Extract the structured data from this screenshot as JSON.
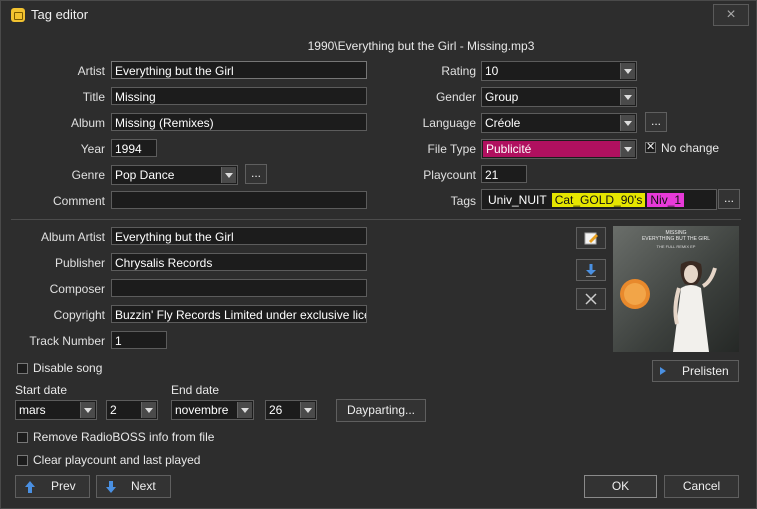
{
  "window": {
    "title": "Tag editor",
    "close_label": "×"
  },
  "file_path": "1990\\Everything but the Girl - Missing.mp3",
  "left_fields": {
    "artist": {
      "label": "Artist",
      "value": "Everything but the Girl"
    },
    "title": {
      "label": "Title",
      "value": "Missing"
    },
    "album": {
      "label": "Album",
      "value": "Missing (Remixes)"
    },
    "year": {
      "label": "Year",
      "value": "1994"
    },
    "genre": {
      "label": "Genre",
      "value": "Pop Dance"
    },
    "comment": {
      "label": "Comment",
      "value": ""
    }
  },
  "right_fields": {
    "rating": {
      "label": "Rating",
      "value": "10"
    },
    "gender": {
      "label": "Gender",
      "value": "Group"
    },
    "language": {
      "label": "Language",
      "value": "Créole"
    },
    "file_type": {
      "label": "File Type",
      "value": "Publicité"
    },
    "no_change": {
      "label": "No change",
      "checked": true
    },
    "playcount": {
      "label": "Playcount",
      "value": "21"
    },
    "tags": {
      "label": "Tags",
      "items": [
        {
          "text": "Univ_NUIT",
          "color": ""
        },
        {
          "text": "Cat_GOLD_90's",
          "color": "#e6e600"
        },
        {
          "text": "Niv_1",
          "color": "#e83ad9"
        }
      ]
    }
  },
  "extra_fields": {
    "album_artist": {
      "label": "Album Artist",
      "value": "Everything but the Girl"
    },
    "publisher": {
      "label": "Publisher",
      "value": "Chrysalis Records"
    },
    "composer": {
      "label": "Composer",
      "value": ""
    },
    "copyright": {
      "label": "Copyright",
      "value": "Buzzin' Fly Records Limited under exclusive licer"
    },
    "track_number": {
      "label": "Track Number",
      "value": "1"
    }
  },
  "cover": {
    "line1": "MISSING",
    "line2": "EVERYTHING BUT THE GIRL",
    "line3": "THE FULL REMIX EP"
  },
  "disable_song": {
    "label": "Disable song",
    "checked": false
  },
  "start_date": {
    "label": "Start date",
    "month": "mars",
    "day": "2"
  },
  "end_date": {
    "label": "End date",
    "month": "novembre",
    "day": "26"
  },
  "dayparting_label": "Dayparting...",
  "prelisten_label": "Prelisten",
  "remove_info": {
    "label": "Remove RadioBOSS info from file",
    "checked": false
  },
  "clear_playcount": {
    "label": "Clear playcount and last played",
    "checked": false
  },
  "buttons": {
    "prev": "Prev",
    "next": "Next",
    "ok": "OK",
    "cancel": "Cancel",
    "dots": "..."
  },
  "colors": {
    "file_type_bg": "#b0105f",
    "accent_blue": "#4a90e2"
  }
}
